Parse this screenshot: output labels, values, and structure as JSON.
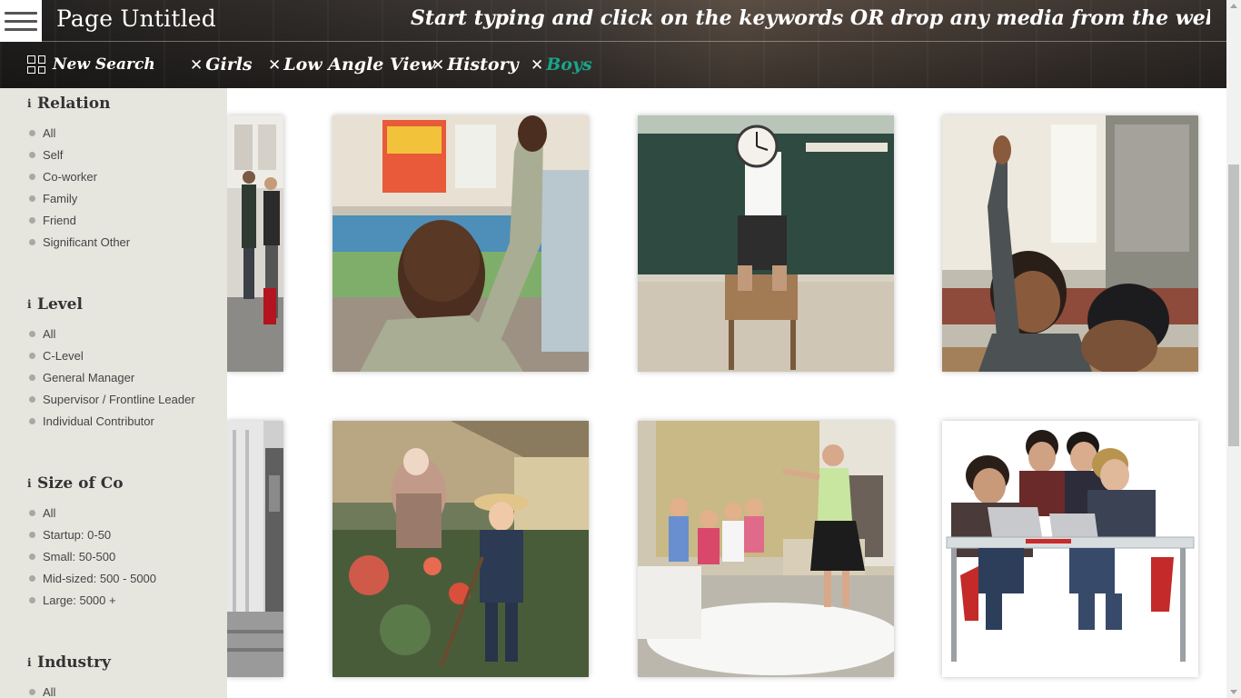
{
  "header": {
    "page_title": "Page Untitled",
    "search_hint": "Start typing and click on the keywords OR drop any media from the web..."
  },
  "filter_bar": {
    "new_search_label": "New Search",
    "tags": [
      {
        "label": "Girls",
        "active": false
      },
      {
        "label": "Low Angle View",
        "active": false
      },
      {
        "label": "History",
        "active": false
      },
      {
        "label": "Boys",
        "active": true
      }
    ],
    "active_tag_color": "#1aa58a"
  },
  "sidebar": {
    "sections": [
      {
        "title": "Relation",
        "options": [
          "All",
          "Self",
          "Co-worker",
          "Family",
          "Friend",
          "Significant Other"
        ]
      },
      {
        "title": "Level",
        "options": [
          "All",
          "C-Level",
          "General Manager",
          "Supervisor / Frontline Leader",
          "Individual Contributor"
        ]
      },
      {
        "title": "Size of Co",
        "options": [
          "All",
          "Startup: 0-50",
          "Small: 50-500",
          "Mid-sized: 500 - 5000",
          "Large: 5000 +"
        ]
      },
      {
        "title": "Industry",
        "options": [
          "All"
        ]
      }
    ]
  },
  "images": [
    {
      "name": "crowd-photo",
      "description_icon": "crowd"
    },
    {
      "name": "boy-raising-hand-photo",
      "description_icon": "classroom"
    },
    {
      "name": "child-holding-clock-photo",
      "description_icon": "clock"
    },
    {
      "name": "girl-raising-hand-photo",
      "description_icon": "classroom"
    },
    {
      "name": "old-building-photo",
      "description_icon": "building"
    },
    {
      "name": "painting-boy-garden",
      "description_icon": "painting"
    },
    {
      "name": "teacher-children-photo",
      "description_icon": "children"
    },
    {
      "name": "men-laptops-photo",
      "description_icon": "laptops"
    }
  ]
}
